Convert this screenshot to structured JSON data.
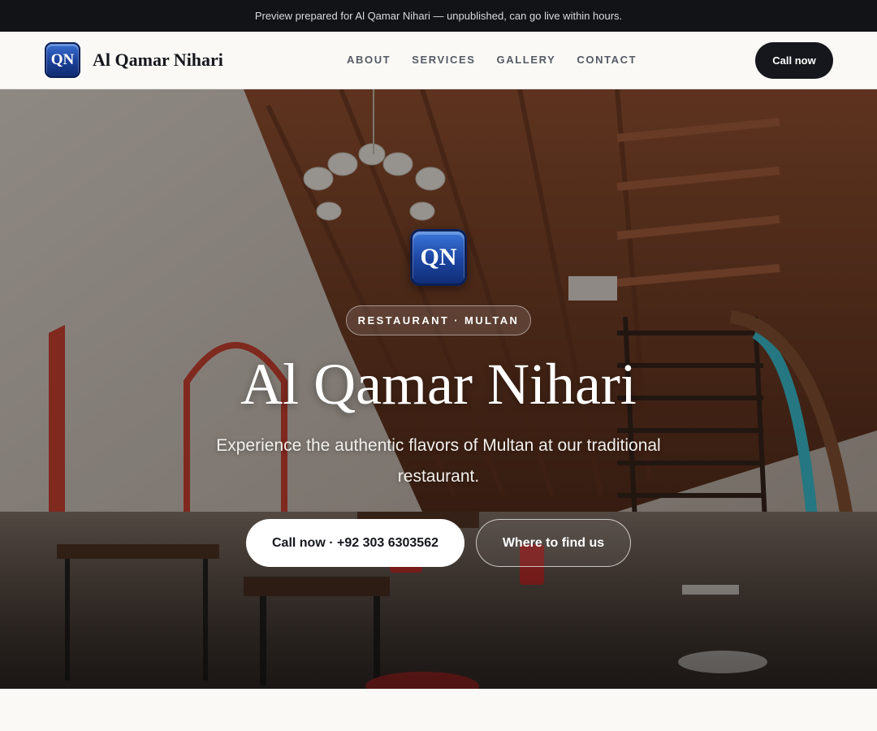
{
  "preview_banner": {
    "text": "Preview prepared for Al Qamar Nihari — unpublished, can go live within hours."
  },
  "header": {
    "logo_text": "QN",
    "brand_name": "Al Qamar Nihari",
    "nav": [
      {
        "label": "ABOUT"
      },
      {
        "label": "SERVICES"
      },
      {
        "label": "GALLERY"
      },
      {
        "label": "CONTACT"
      }
    ],
    "cta_label": "Call now"
  },
  "hero": {
    "logo_text": "QN",
    "tag": "RESTAURANT · MULTAN",
    "title": "Al Qamar Nihari",
    "subtitle": "Experience the authentic flavors of Multan at our traditional restaurant.",
    "primary_button": "Call now · +92 303 6303562",
    "secondary_button": "Where to find us"
  },
  "colors": {
    "topbar_bg": "#111317",
    "header_bg": "#faf9f6",
    "dark_button": "#15171c",
    "logo_blue": "#1c44a0"
  }
}
